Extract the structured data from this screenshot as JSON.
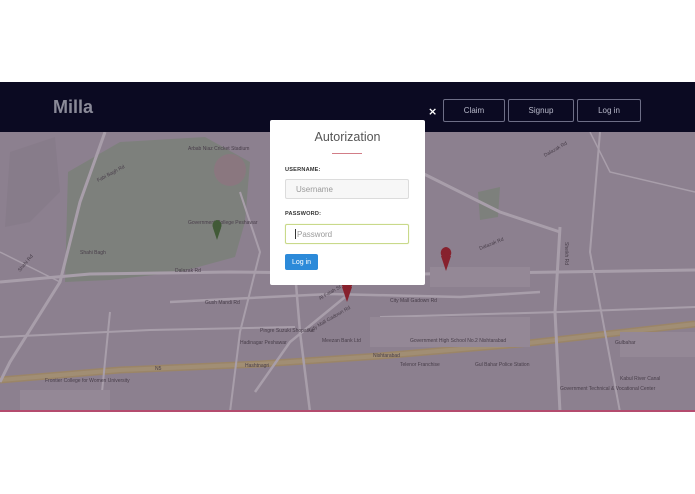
{
  "navbar": {
    "brand": "Milla",
    "buttons": {
      "claim": "Claim",
      "signup": "Signup",
      "login": "Log in"
    }
  },
  "modal": {
    "close_symbol": "×",
    "title": "Autorization",
    "username": {
      "label": "USERNAME:",
      "placeholder": "Username",
      "value": ""
    },
    "password": {
      "label": "PASSWORD:",
      "placeholder": "Password",
      "value": ""
    },
    "submit_label": "Log in"
  },
  "map": {
    "labels": {
      "fabi_bagh": "Fabi Bagh Rd",
      "dalazak1": "Dalazak Rd",
      "dalazak2": "Dalazak Rd",
      "dalazak3": "Dalazak Rd",
      "shahi_bagh": "Shahi Bagh",
      "gov_college": "Government College Peshawar",
      "arbab_niaz": "Arbab Niaz Cricket Stadium",
      "shahi_rd": "Shahi Rd",
      "rasalah": "Rasalah Rd",
      "gush_mandi": "Gush Mandi Rd",
      "al_falah": "Al Falah St",
      "city_mall": "City Mall Gadown Rd",
      "city_mall2": "City Mall Gadown Rd",
      "honda": "Pingre Suzuki Shopatkar",
      "hadinagar": "Hadinagar Peshawar",
      "meezan": "Meezan Bank Ltd",
      "nishtarabad": "Nishtarabad",
      "gov_high": "Government High School No.2 Nishtarabad",
      "telenor": "Telenor Franchise",
      "gul_bahar": "Gul Bahar Police Station",
      "gulbahar": "Gulbahar",
      "frontier": "Frontier College for Women University",
      "kabul_river": "Kabul River Canal",
      "hashtnagri": "Hashtnagri",
      "gov_technical": "Government Technical & Vocational Center",
      "n5": "N5",
      "sheikh": "Sheikh Rd"
    },
    "pins": [
      "red-marker",
      "red-marker",
      "green-marker"
    ]
  },
  "colors": {
    "navbar_bg": "#0b0a22",
    "primary_button": "#2c8ad9",
    "title_underline": "#d27d87",
    "map_overlay": "#301834"
  }
}
